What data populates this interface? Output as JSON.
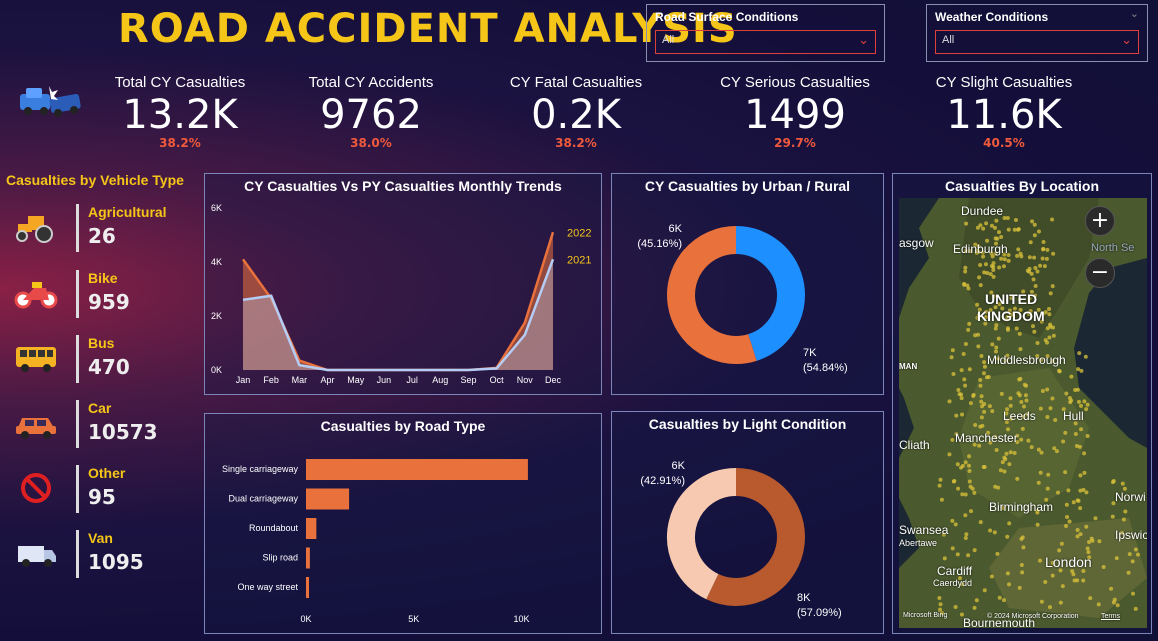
{
  "header": {
    "title": "ROAD ACCIDENT ANALYSIS"
  },
  "filters": [
    {
      "label": "Road Surface Conditions",
      "value": "All"
    },
    {
      "label": "Weather Conditions",
      "value": "All"
    }
  ],
  "kpis": [
    {
      "label": "Total CY Casualties",
      "value": "13.2K",
      "pct": "38.2%"
    },
    {
      "label": "Total CY Accidents",
      "value": "9762",
      "pct": "38.0%"
    },
    {
      "label": "CY Fatal Casualties",
      "value": "0.2K",
      "pct": "38.2%"
    },
    {
      "label": "CY Serious Casualties",
      "value": "1499",
      "pct": "29.7%"
    },
    {
      "label": "CY Slight Casualties",
      "value": "11.6K",
      "pct": "40.5%"
    }
  ],
  "vehicle_types": {
    "title": "Casualties by Vehicle Type",
    "items": [
      {
        "name": "Agricultural",
        "value": "26",
        "icon": "tractor-icon"
      },
      {
        "name": "Bike",
        "value": "959",
        "icon": "motorbike-icon"
      },
      {
        "name": "Bus",
        "value": "470",
        "icon": "bus-icon"
      },
      {
        "name": "Car",
        "value": "10573",
        "icon": "car-icon"
      },
      {
        "name": "Other",
        "value": "95",
        "icon": "prohibited-icon"
      },
      {
        "name": "Van",
        "value": "1095",
        "icon": "van-icon"
      }
    ]
  },
  "colors": {
    "accent": "#f5c518",
    "orange": "#e8713c",
    "blue": "#1e8fff",
    "light_peach": "#f7c9b0",
    "brown": "#b85a2e",
    "pct": "#f05a3c"
  },
  "chart_data": [
    {
      "type": "area",
      "title": "CY Casualties Vs PY Casualties Monthly Trends",
      "categories": [
        "Jan",
        "Feb",
        "Mar",
        "Apr",
        "May",
        "Jun",
        "Jul",
        "Aug",
        "Sep",
        "Oct",
        "Nov",
        "Dec"
      ],
      "y_ticks": [
        "0K",
        "2K",
        "4K",
        "6K"
      ],
      "ylim": [
        0,
        6000
      ],
      "series": [
        {
          "name": "2022",
          "values": [
            4100,
            2650,
            350,
            0,
            0,
            0,
            0,
            0,
            0,
            80,
            1750,
            5100
          ]
        },
        {
          "name": "2021",
          "values": [
            2600,
            2750,
            180,
            0,
            0,
            0,
            0,
            0,
            0,
            60,
            1300,
            4100
          ]
        }
      ]
    },
    {
      "type": "pie",
      "title": "CY Casualties by Urban / Rural",
      "slices": [
        {
          "value": 45.16,
          "label": "6K",
          "pct": "(45.16%)"
        },
        {
          "value": 54.84,
          "label": "7K",
          "pct": "(54.84%)"
        }
      ]
    },
    {
      "type": "bar",
      "title": "Casualties by Road Type",
      "categories": [
        "Single carriageway",
        "Dual carriageway",
        "Roundabout",
        "Slip road",
        "One way street"
      ],
      "values": [
        10300,
        2000,
        480,
        180,
        140
      ],
      "x_ticks": [
        "0K",
        "5K",
        "10K"
      ],
      "xlim": [
        0,
        11000
      ]
    },
    {
      "type": "pie",
      "title": "Casualties by Light Condition",
      "slices": [
        {
          "value": 42.91,
          "label": "6K",
          "pct": "(42.91%)"
        },
        {
          "value": 57.09,
          "label": "8K",
          "pct": "(57.09%)"
        }
      ]
    }
  ],
  "map": {
    "title": "Casualties By Location",
    "places": [
      "Dundee",
      "Edinburgh",
      "asgow",
      "UNITED",
      "KINGDOM",
      "Middlesbrough",
      "Leeds",
      "Hull",
      "Manchester",
      "Cliath",
      "Birmingham",
      "Norwi",
      "Swansea",
      "Abertawe",
      "Ipswic",
      "Cardiff",
      "Caerdydd",
      "London",
      "Bournemouth",
      "North Se",
      "MAN"
    ],
    "attribution": "Microsoft Bing",
    "copyright": "© 2024 Microsoft Corporation",
    "terms": "Terms"
  }
}
